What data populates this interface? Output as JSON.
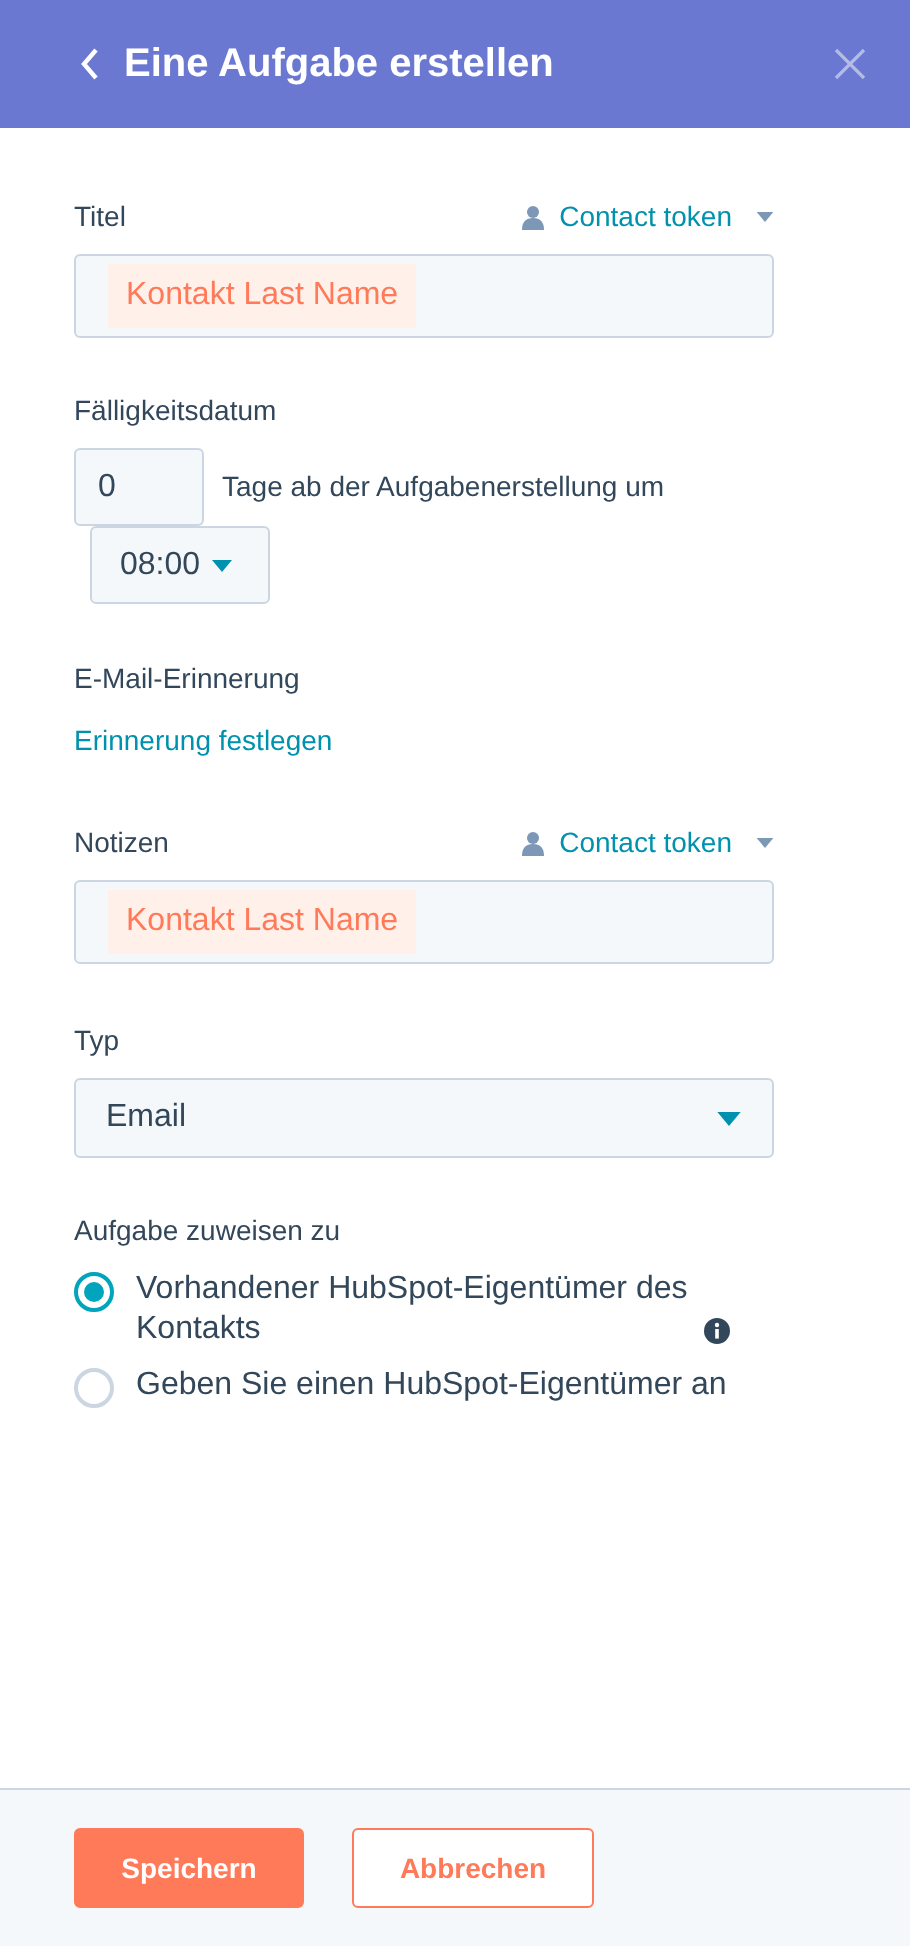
{
  "header": {
    "title": "Eine Aufgabe erstellen"
  },
  "title_field": {
    "label": "Titel",
    "token_menu": "Contact token",
    "token": "Kontakt Last Name"
  },
  "due_date": {
    "label": "Fälligkeitsdatum",
    "days": "0",
    "suffix": "Tage ab der Aufgabenerstellung um",
    "time": "08:00"
  },
  "reminder": {
    "label": "E-Mail-Erinnerung",
    "link": "Erinnerung festlegen"
  },
  "notes_field": {
    "label": "Notizen",
    "token_menu": "Contact token",
    "token": "Kontakt Last Name"
  },
  "type_field": {
    "label": "Typ",
    "value": "Email"
  },
  "assign": {
    "label": "Aufgabe zuweisen zu",
    "options": [
      {
        "label": "Vorhandener HubSpot-Eigentümer des Kontakts",
        "selected": true,
        "info": true
      },
      {
        "label": "Geben Sie einen HubSpot-Eigentümer an",
        "selected": false,
        "info": false
      }
    ]
  },
  "buttons": [
    {
      "label": "Speichern",
      "kind": "primary"
    },
    {
      "label": "Abbrechen",
      "kind": "secondary"
    }
  ]
}
